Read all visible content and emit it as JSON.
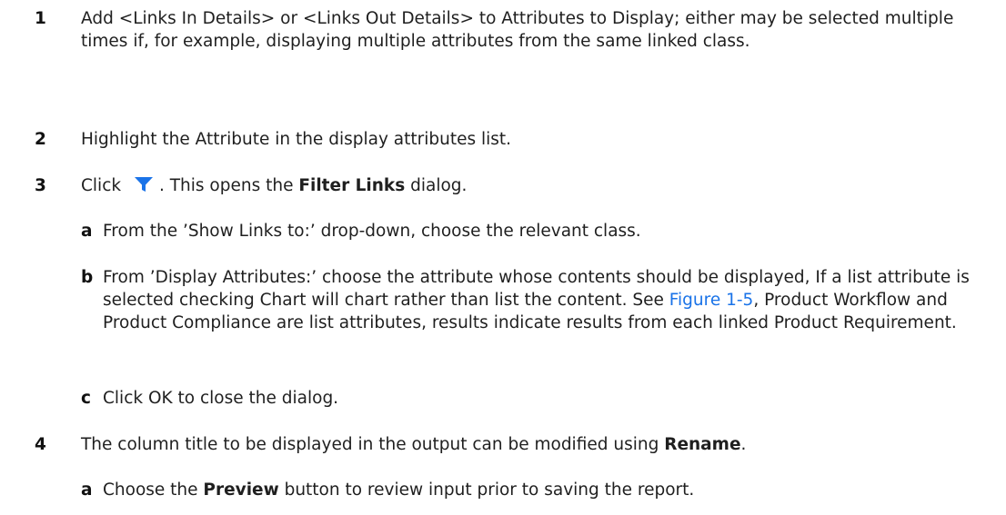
{
  "steps": [
    {
      "number": "1",
      "text": "Add <Links In Details> or <Links Out Details> to Attributes to Display; either may be selected multiple times if, for example, displaying multiple attributes from the same linked class."
    },
    {
      "number": "2",
      "text": "Highlight the Attribute in the display attributes list."
    },
    {
      "number": "3",
      "prefix": "Click",
      "middle": ". This opens the ",
      "bold": "Filter Links",
      "suffix": " dialog.",
      "icon": "filter-icon",
      "substeps": [
        {
          "letter": "a",
          "text": "From the ’Show Links to:’ drop-down, choose the relevant class."
        },
        {
          "letter": "b",
          "text_before": "From ’Display Attributes:’ choose the attribute whose contents should be displayed, If a list attribute is selected checking Chart will chart rather than list the content. See ",
          "link": "Figure 1-5",
          "text_after": ", Product Workflow and Product Compliance are list attributes, results indicate results from each linked Product Requirement."
        },
        {
          "letter": "c",
          "text": "Click OK to close the dialog."
        }
      ]
    },
    {
      "number": "4",
      "text_before": "The column title to be displayed in the output can be modified using ",
      "bold": "Rename",
      "text_after": ".",
      "substeps": [
        {
          "letter": "a",
          "before": "Choose the ",
          "bold": "Preview",
          "after": " button to review input prior to saving the report."
        }
      ]
    }
  ],
  "colors": {
    "icon": "#1a73e8",
    "link": "#1a73e8",
    "text": "#1f1f1f"
  }
}
